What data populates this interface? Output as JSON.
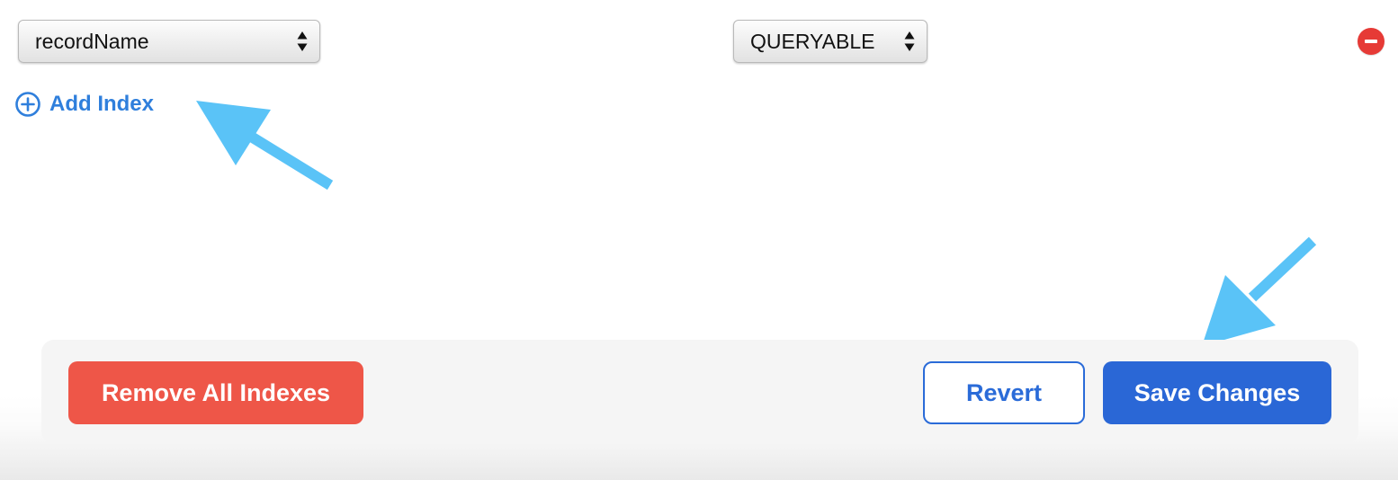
{
  "index_row": {
    "field_select": {
      "value": "recordName"
    },
    "type_select": {
      "value": "QUERYABLE"
    },
    "remove_icon": "minus-circle-icon"
  },
  "add_index": {
    "icon": "plus-circle-icon",
    "label": "Add Index"
  },
  "footer": {
    "remove_all_label": "Remove All Indexes",
    "revert_label": "Revert",
    "save_label": "Save Changes"
  },
  "annotations": {
    "arrow_color": "#5ac3f7",
    "arrow_targets": [
      "add-index-button",
      "save-changes-button"
    ]
  },
  "colors": {
    "link_blue": "#2f7fdc",
    "primary_blue": "#2a67d6",
    "danger_red": "#ee5648",
    "remove_icon_red": "#e63a36",
    "footer_background": "#f5f5f5"
  }
}
